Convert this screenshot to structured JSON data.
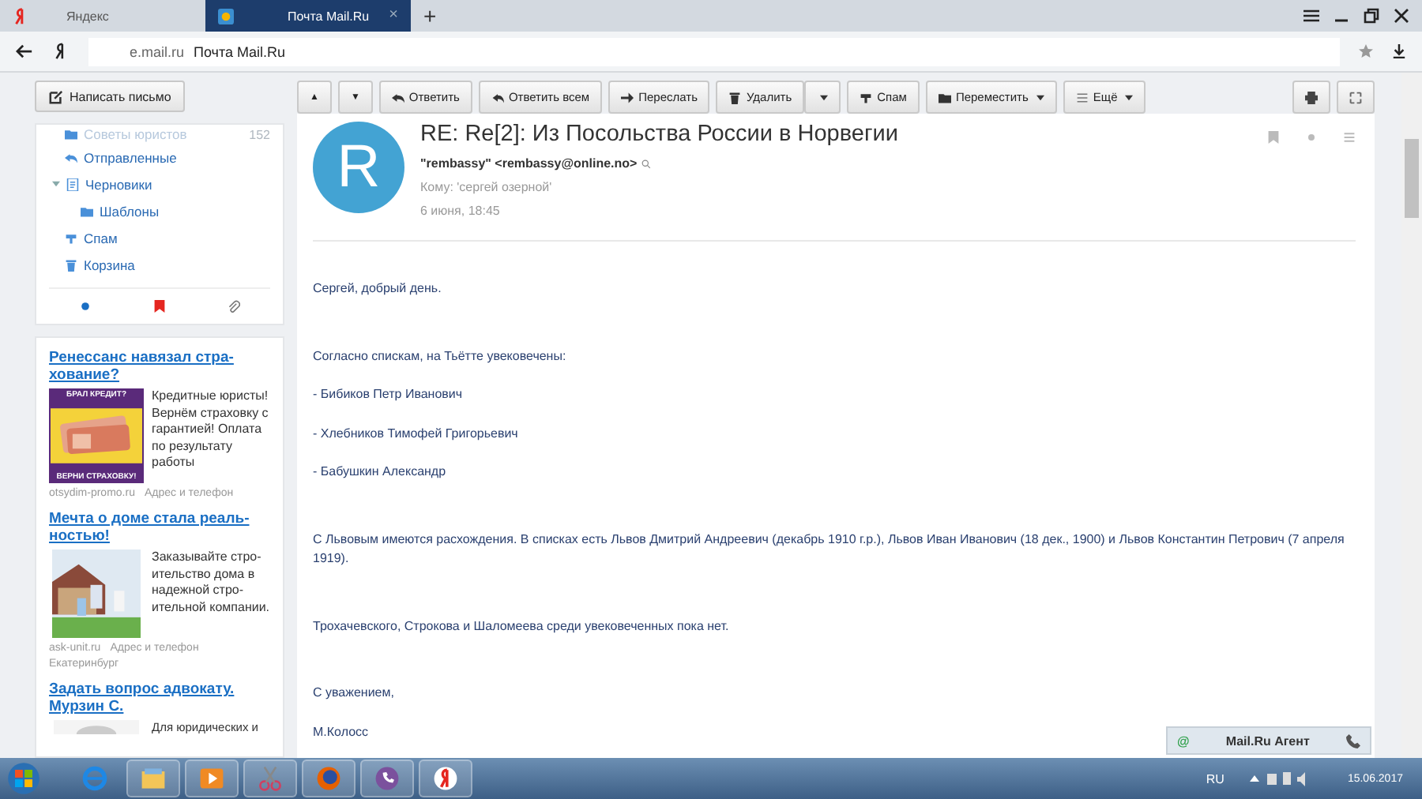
{
  "browser": {
    "tabs": [
      {
        "kind": "yandex",
        "title": "Яндекс",
        "selected": false
      },
      {
        "kind": "mail",
        "title": "Почта Mail.Ru",
        "selected": true,
        "close": "×"
      }
    ],
    "new_tab": "+",
    "address": {
      "domain": "e.mail.ru",
      "page_title": "Почта Mail.Ru"
    }
  },
  "compose_button": "Написать письмо",
  "folders": [
    {
      "kind": "folder",
      "name": "Советы юристов",
      "count": "152"
    },
    {
      "kind": "sent",
      "name": "Отправленные"
    },
    {
      "kind": "draft",
      "name": "Черновики",
      "expanded": true,
      "children": [
        {
          "kind": "folder",
          "name": "Шаблоны"
        }
      ]
    },
    {
      "kind": "spam",
      "name": "Спам"
    },
    {
      "kind": "trash",
      "name": "Корзина"
    }
  ],
  "ads": [
    {
      "kind": "banknotes",
      "title": "Ренессанс навязал стра-хование?",
      "text": "Кредитные юристы! Вернём страховку с гарантией! Оплата по результату работы",
      "banner_top": "БРАЛ КРЕДИТ?",
      "banner_bottom": "ВЕРНИ СТРАХОВКУ!",
      "site": "otsydim-promo.ru",
      "contact": "Адрес и телефон"
    },
    {
      "kind": "family",
      "title": "Мечта о доме стала реаль-ностью!",
      "text": "Заказывайте стро-ительство дома в надежной стро-ительной компании.",
      "site": "ask-unit.ru",
      "contact": "Адрес и телефон",
      "city": "Екатеринбург"
    },
    {
      "kind": "person",
      "title": "Задать вопрос адвокату. Мурзин С.",
      "text": "Для юридических и"
    }
  ],
  "toolbar": [
    {
      "kind": "up",
      "label": "▲"
    },
    {
      "kind": "down",
      "label": "▼"
    },
    {
      "kind": "reply",
      "label": "Ответить"
    },
    {
      "kind": "replyall",
      "label": "Ответить всем"
    },
    {
      "kind": "forward",
      "label": "Переслать"
    },
    {
      "kind": "delete",
      "label": "Удалить"
    },
    {
      "kind": "spam",
      "label": "Спам"
    },
    {
      "kind": "move",
      "label": "Переместить"
    },
    {
      "kind": "more",
      "label": "Ещё"
    }
  ],
  "message": {
    "avatar_letter": "R",
    "subject": "RE: Re[2]: Из Посольства России в Норвегии",
    "from": "\"rembassy\" <rembassy@online.no>",
    "to": "Кому: 'сергей озерной'",
    "date": "6 июня, 18:45",
    "flagged": false,
    "body": [
      [
        "Сергей, добрый день."
      ],
      [
        "Согласно спискам, на Тьётте увековечены:",
        "- Бибиков Петр Иванович",
        "- Хлебников Тимофей Григорьевич",
        "- Бабушкин Александр"
      ],
      [
        "С Львовым имеются расхождения. В списках есть Львов Дмитрий Андреевич (декабрь 1910 г.р.), Львов Иван Иванович (18 дек., 1900) и Львов Константин Петрович (7 апреля 1919)."
      ],
      [
        "Трохачевского, Строкова и Шаломеева среди увековеченных пока нет."
      ],
      [
        "С уважением,",
        "М.Колосс"
      ]
    ]
  },
  "agent": {
    "symbol": "@",
    "title": "Mail.Ru Агент"
  },
  "taskbar": {
    "apps": [
      {
        "kind": "ie"
      },
      {
        "kind": "explorer"
      },
      {
        "kind": "media"
      },
      {
        "kind": "scissors"
      },
      {
        "kind": "firefox"
      },
      {
        "kind": "viber"
      },
      {
        "kind": "yandex"
      }
    ],
    "language": "RU",
    "date": "15.06.2017"
  }
}
